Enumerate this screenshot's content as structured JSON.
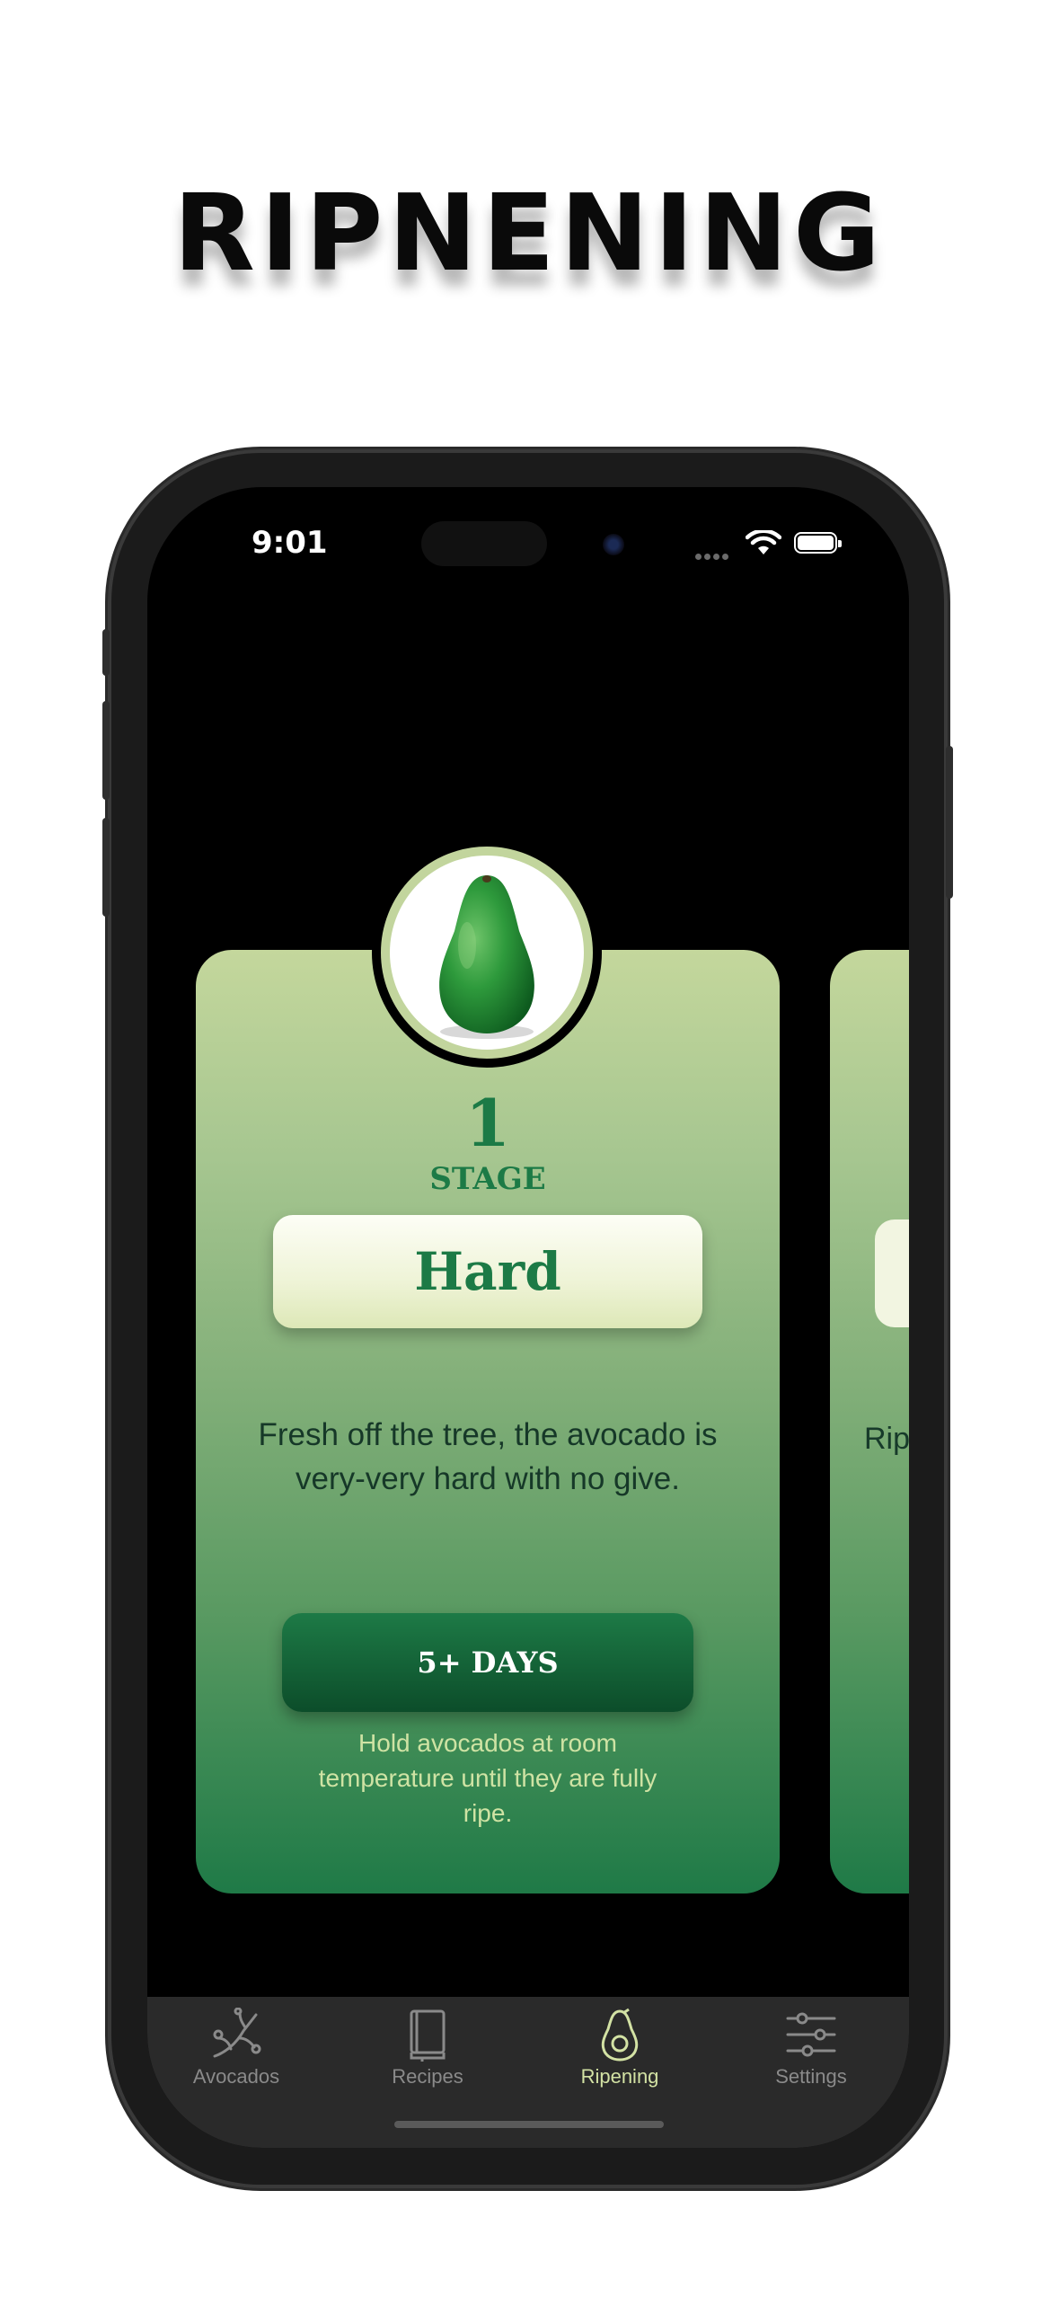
{
  "headline": "RIPNENING",
  "status": {
    "time": "9:01"
  },
  "card": {
    "stage_number": "1",
    "stage_label": "STAGE",
    "stage_name": "Hard",
    "description": "Fresh off the tree, the avocado is very-very hard with no give.",
    "days": "5+ DAYS",
    "tip": "Hold avocados at room temperature until they are fully ripe."
  },
  "next_card": {
    "text_peek": "Rip"
  },
  "tabs": [
    {
      "label": "Avocados",
      "icon": "branch-icon",
      "active": false
    },
    {
      "label": "Recipes",
      "icon": "book-icon",
      "active": false
    },
    {
      "label": "Ripening",
      "icon": "avocado-icon",
      "active": true
    },
    {
      "label": "Settings",
      "icon": "sliders-icon",
      "active": false
    }
  ],
  "colors": {
    "accent_green": "#1c7a46",
    "tab_active": "#d3e2a4",
    "card_top": "#c4d79c",
    "card_bottom": "#1f7a47"
  }
}
